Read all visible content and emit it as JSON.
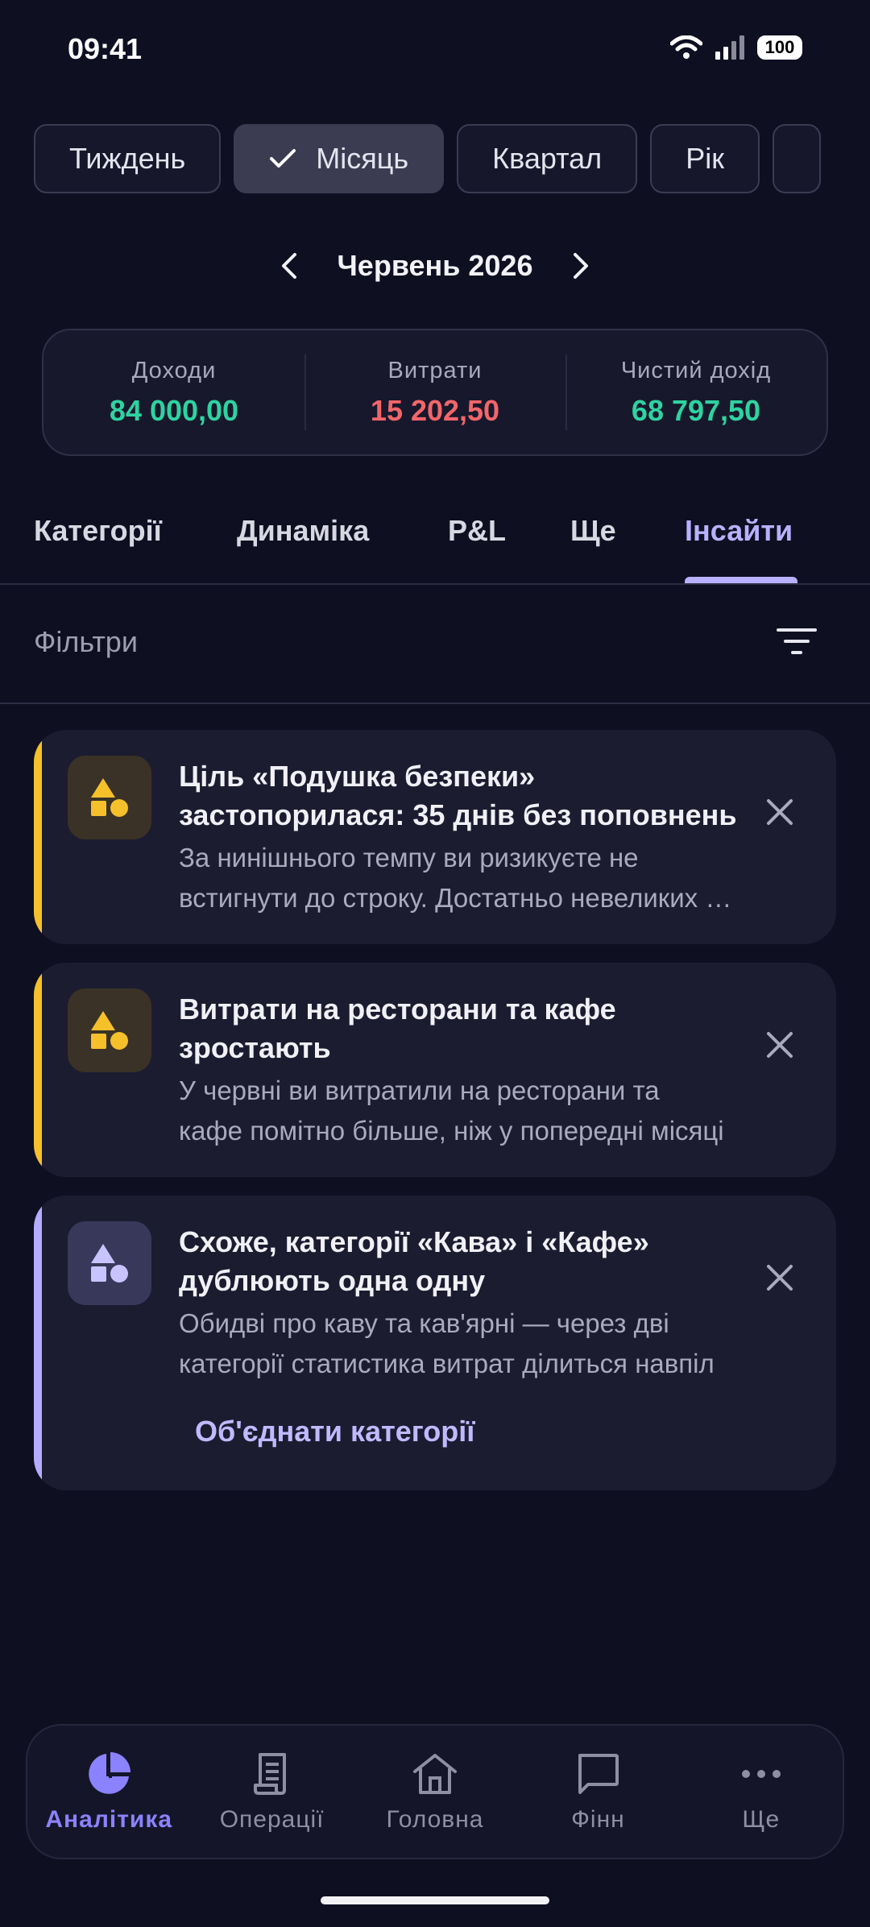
{
  "status_bar": {
    "time": "09:41",
    "battery": "100"
  },
  "periods": [
    {
      "label": "Тиждень",
      "selected": false
    },
    {
      "label": "Місяць",
      "selected": true
    },
    {
      "label": "Квартал",
      "selected": false
    },
    {
      "label": "Рік",
      "selected": false
    }
  ],
  "month": {
    "label": "Червень 2026"
  },
  "summary": {
    "income": {
      "label": "Доходи",
      "value": "84 000,00",
      "color": "#2ed3a0"
    },
    "expenses": {
      "label": "Витрати",
      "value": "15 202,50",
      "color": "#f2666a"
    },
    "net": {
      "label": "Чистий дохід",
      "value": "68 797,50",
      "color": "#2ed3a0"
    }
  },
  "tabs": [
    {
      "label": "Категорії"
    },
    {
      "label": "Динаміка"
    },
    {
      "label": "P&L"
    },
    {
      "label": "Ще"
    },
    {
      "label": "Інсайти",
      "active": true
    }
  ],
  "filters": {
    "label": "Фільтри"
  },
  "insights": [
    {
      "title_lines": [
        "Ціль «Подушка безпеки»",
        "застопорилася: 35 днів без поповнень"
      ],
      "body_lines": [
        "За нинішнього темпу ви ризикуєте не",
        "встигнути до строку. Достатньо невеликих внесків"
      ],
      "accent": "#f5c02a",
      "icon_color": "#f5c02a",
      "icon": "shapes-icon"
    },
    {
      "title_lines": [
        "Витрати на ресторани та кафе",
        "зростають"
      ],
      "body_lines": [
        "У червні ви витратили на ресторани та",
        "кафе помітно більше, ніж у попередні місяці"
      ],
      "accent": "#f5c02a",
      "icon_color": "#f5c02a",
      "icon": "shapes-icon"
    },
    {
      "title_lines": [
        "Схоже, категорії «Кава» і «Кафе»",
        "дублюють одна одну"
      ],
      "body_lines": [
        "Обидві про каву та кав'ярні — через дві",
        "категорії статистика витрат ділиться навпіл"
      ],
      "accent": "#b6acff",
      "icon_color": "#c9c3ff",
      "icon": "shapes-icon",
      "action": "Об'єднати категорії"
    }
  ],
  "bottom_nav": [
    {
      "label": "Аналітика",
      "icon": "pie-chart-icon",
      "active": true
    },
    {
      "label": "Операції",
      "icon": "receipt-icon"
    },
    {
      "label": "Головна",
      "icon": "home-icon"
    },
    {
      "label": "Фінн",
      "icon": "chat-icon"
    },
    {
      "label": "Ще",
      "icon": "more-icon"
    }
  ]
}
